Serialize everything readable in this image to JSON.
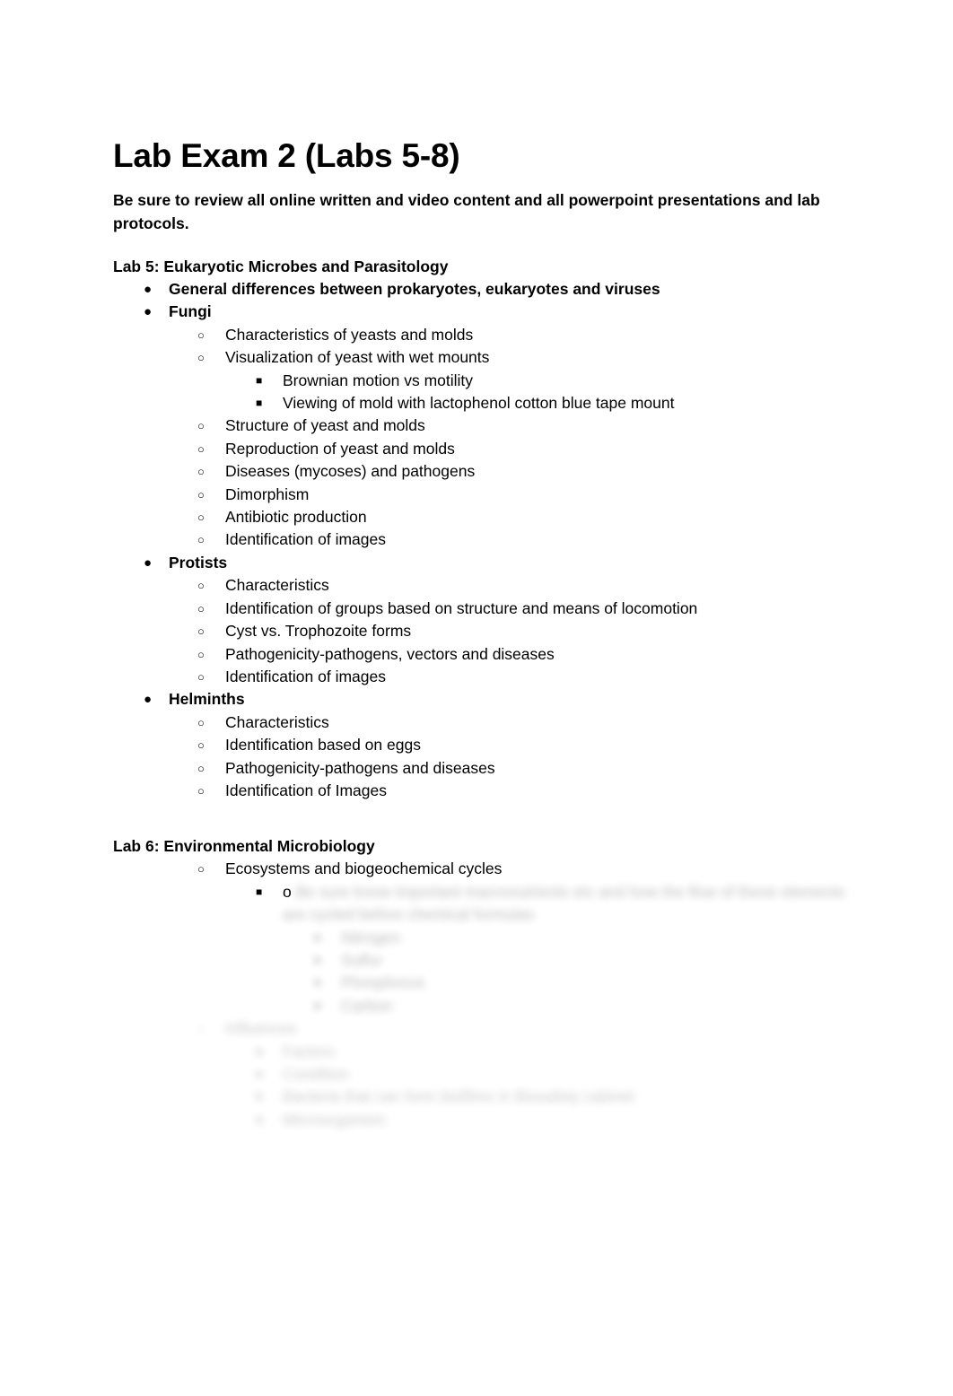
{
  "document": {
    "title": "Lab Exam 2 (Labs 5-8)",
    "lead": "Be sure to review all online written and video content and all powerpoint presentations and lab protocols."
  },
  "bullets": {
    "disc": "●",
    "circle": "○",
    "square": "■",
    "letter_o": "o"
  },
  "sections": [
    {
      "heading": "Lab 5: Eukaryotic Microbes and Parasitology",
      "items": [
        {
          "level": 1,
          "text": "General differences between prokaryotes, eukaryotes and viruses"
        },
        {
          "level": 1,
          "text": "Fungi"
        },
        {
          "level": 2,
          "text": "Characteristics of yeasts and molds"
        },
        {
          "level": 2,
          "text": "Visualization of yeast with wet mounts"
        },
        {
          "level": 3,
          "text": "Brownian motion vs motility"
        },
        {
          "level": 3,
          "text": "Viewing of mold with lactophenol cotton blue tape mount"
        },
        {
          "level": 2,
          "text": "Structure of yeast and molds"
        },
        {
          "level": 2,
          "text": "Reproduction of yeast and molds"
        },
        {
          "level": 2,
          "text": "Diseases (mycoses) and pathogens"
        },
        {
          "level": 2,
          "text": "Dimorphism"
        },
        {
          "level": 2,
          "text": "Antibiotic production"
        },
        {
          "level": 2,
          "text": "Identification of images"
        },
        {
          "level": 1,
          "text": "Protists"
        },
        {
          "level": 2,
          "text": "Characteristics"
        },
        {
          "level": 2,
          "text": "Identification of groups based on structure and means of locomotion"
        },
        {
          "level": 2,
          "text": "Cyst vs. Trophozoite forms"
        },
        {
          "level": 2,
          "text": "Pathogenicity-pathogens, vectors and diseases"
        },
        {
          "level": 2,
          "text": "Identification of images"
        },
        {
          "level": 1,
          "text": "Helminths"
        },
        {
          "level": 2,
          "text": "Characteristics"
        },
        {
          "level": 2,
          "text": "Identification based on eggs"
        },
        {
          "level": 2,
          "text": "Pathogenicity-pathogens and diseases"
        },
        {
          "level": 2,
          "text": "Identification of Images"
        }
      ]
    },
    {
      "heading": "Lab 6: Environmental Microbiology",
      "items": [
        {
          "level": 2,
          "text": "Ecosystems and biogeochemical cycles"
        }
      ]
    }
  ],
  "redacted": {
    "note": "blurred-illegible",
    "lines": [
      {
        "level": 3,
        "prefix": "o",
        "text": "Be sure know important macronutrients etc and how the flow of these elements are cycled before chemical formulas",
        "blur": true
      },
      {
        "level": 4,
        "text": "Nitrogen",
        "blur": true
      },
      {
        "level": 4,
        "text": "Sulfur",
        "blur": true
      },
      {
        "level": 4,
        "text": "Phosphorus",
        "blur": true
      },
      {
        "level": 4,
        "text": "Carbon",
        "blur": true
      },
      {
        "level": 2,
        "text": "Influences",
        "blur": true
      },
      {
        "level": 3,
        "text": "Factors",
        "blur": true
      },
      {
        "level": 3,
        "text": "Condition",
        "blur": true
      },
      {
        "level": 3,
        "text": "Bacteria that can form biofilms in Biosafety cabinet",
        "blur": true
      },
      {
        "level": 3,
        "text": "Microorganism",
        "blur": true
      }
    ]
  }
}
